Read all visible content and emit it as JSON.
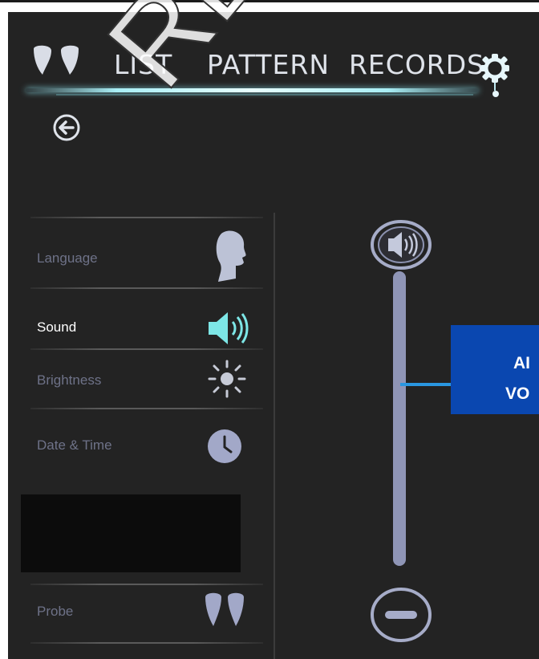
{
  "nav": {
    "tabs": [
      {
        "label": "LIST"
      },
      {
        "label": "PATTERN"
      },
      {
        "label": "RECORDS"
      }
    ],
    "icons": {
      "logo": "probe-footprints-icon",
      "settings": "gear-icon"
    }
  },
  "back_icon": "back-arrow-icon",
  "settings": [
    {
      "label": "Language",
      "icon": "head-profile-icon",
      "active": false
    },
    {
      "label": "Sound",
      "icon": "speaker-icon",
      "active": true
    },
    {
      "label": "Brightness",
      "icon": "sun-icon",
      "active": false
    },
    {
      "label": "Date & Time",
      "icon": "clock-icon",
      "active": false
    },
    {
      "label": "Probe",
      "icon": "probe-footprints-icon",
      "active": false
    }
  ],
  "volume": {
    "max_icon": "speaker-icon",
    "min_icon": "minus-icon"
  },
  "callout": {
    "line1": "AI",
    "line2": "VO"
  },
  "watermark": "REJUV",
  "colors": {
    "background": "#232323",
    "active_label": "#ffffff",
    "inactive_label": "#6e7288",
    "accent": "#a8eef5",
    "slider": "#8f95b6",
    "callout": "#0a47b0",
    "callout_line": "#2a97e0"
  }
}
